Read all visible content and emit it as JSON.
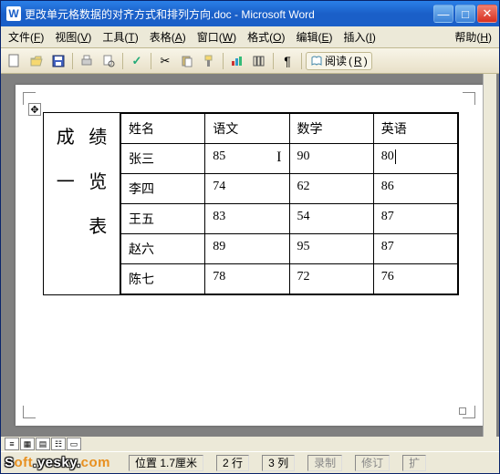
{
  "titlebar": {
    "icon_letter": "W",
    "title": "更改单元格数据的对齐方式和排列方向.doc - Microsoft Word"
  },
  "menu": {
    "file": "文件",
    "file_k": "F",
    "view": "视图",
    "view_k": "V",
    "tools": "工具",
    "tools_k": "T",
    "table": "表格",
    "table_k": "A",
    "window": "窗口",
    "window_k": "W",
    "format": "格式",
    "format_k": "O",
    "edit": "编辑",
    "edit_k": "E",
    "insert": "插入",
    "insert_k": "I",
    "help": "帮助",
    "help_k": "H"
  },
  "toolbar": {
    "read_label": "阅读"
  },
  "side_title": {
    "col1": [
      "成",
      "一"
    ],
    "col2": [
      "绩",
      "览",
      "表"
    ]
  },
  "table": {
    "headers": [
      "姓名",
      "语文",
      "数学",
      "英语"
    ],
    "rows": [
      {
        "name": "张三",
        "chinese": "85",
        "math": "90",
        "english": "80"
      },
      {
        "name": "李四",
        "chinese": "74",
        "math": "62",
        "english": "86"
      },
      {
        "name": "王五",
        "chinese": "83",
        "math": "54",
        "english": "87"
      },
      {
        "name": "赵六",
        "chinese": "89",
        "math": "95",
        "english": "87"
      },
      {
        "name": "陈七",
        "chinese": "78",
        "math": "72",
        "english": "76"
      }
    ]
  },
  "status": {
    "pos_label": "位置",
    "pos_value": "1.7厘米",
    "line_value": "2 行",
    "col_value": "3 列",
    "rec": "录制",
    "rev": "修订",
    "ext": "扩"
  },
  "watermark": {
    "soft": "S",
    "oft": "oft",
    "dot": ".",
    "yesky": "yesky",
    "com": "c",
    "om": "om"
  }
}
